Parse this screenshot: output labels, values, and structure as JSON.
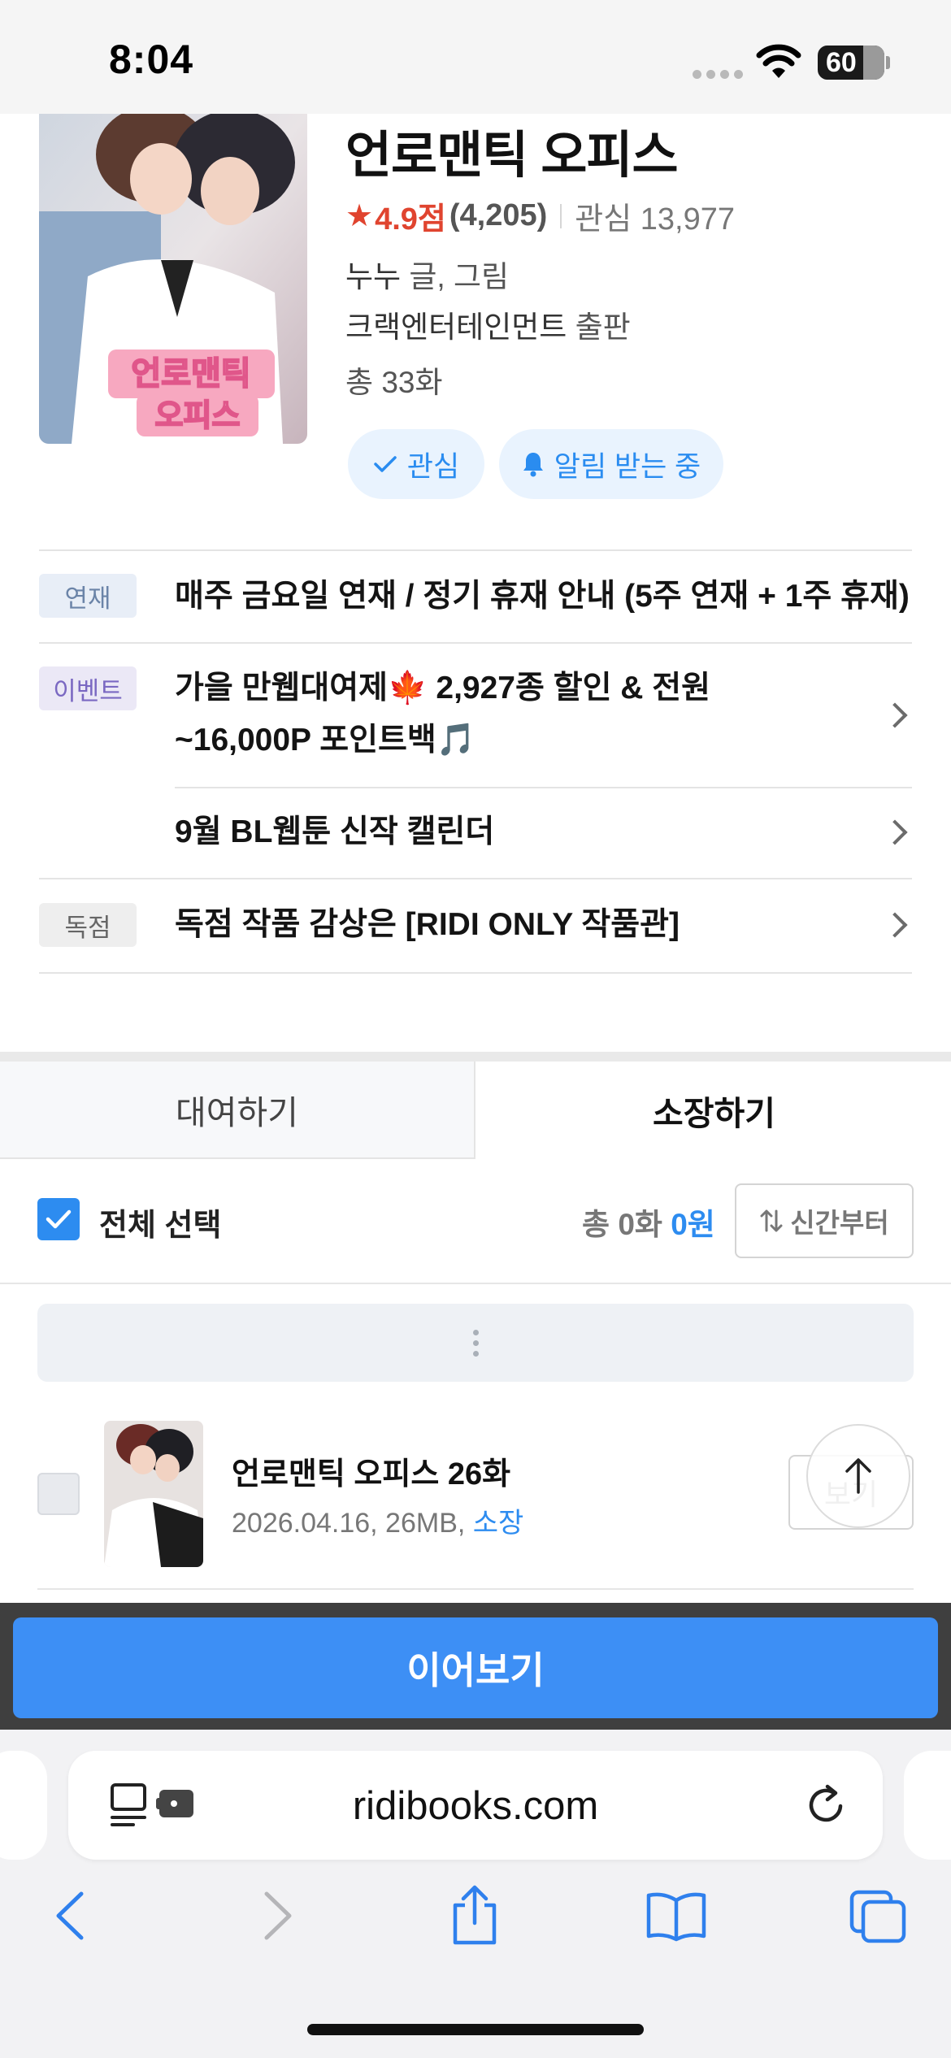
{
  "status_bar": {
    "time": "8:04",
    "battery": "60"
  },
  "book": {
    "title": "언로맨틱 오피스",
    "cover_text_1": "언로맨틱",
    "cover_text_2": "오피스",
    "rating": "4.9점",
    "rating_count": "(4,205)",
    "interest": "관심 13,977",
    "author": "누누",
    "author_suffix": " 글, 그림",
    "publisher": "크랙엔터테인먼트",
    "publisher_suffix": " 출판",
    "total_episodes": "총 33화",
    "interest_button": "관심",
    "notify_button": "알림 받는 중"
  },
  "notices": [
    {
      "tag": "연재",
      "text": "매주 금요일 연재 / 정기 휴재 안내 (5주 연재 + 1주 휴재)"
    },
    {
      "tag": "이벤트",
      "text_line1": "가을 만웹대여제🍁 2,927종 할인 & 전원",
      "text_line2": "~16,000P 포인트백🎵"
    },
    {
      "tag": "",
      "text": "9월 BL웹툰 신작 캘린더"
    },
    {
      "tag": "독점",
      "text": "독점 작품 감상은 [RIDI ONLY 작품관]"
    }
  ],
  "tabs": {
    "rent": "대여하기",
    "own": "소장하기"
  },
  "select_bar": {
    "select_all": "전체 선택",
    "total_prefix": "총 0화 ",
    "total_price": "0원",
    "sort": "신간부터"
  },
  "episode": {
    "title": "언로맨틱 오피스 26화",
    "meta": "2026.04.16, 26MB, ",
    "status": "소장",
    "view": "보기"
  },
  "continue_button": "이어보기",
  "browser": {
    "url": "ridibooks.com"
  },
  "colors": {
    "accent": "#2d8cf0",
    "rating": "#e0442f",
    "continue": "#3d8ff5"
  }
}
